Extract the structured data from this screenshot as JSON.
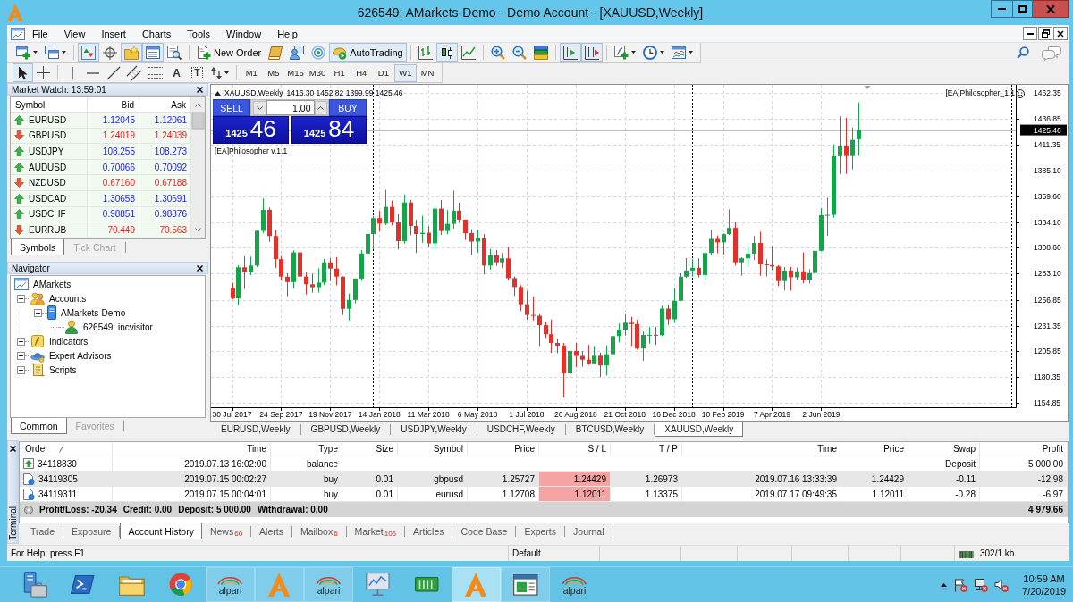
{
  "window": {
    "title": "626549: AMarkets-Demo - Demo Account - [XAUUSD,Weekly]"
  },
  "menu": [
    "File",
    "View",
    "Insert",
    "Charts",
    "Tools",
    "Window",
    "Help"
  ],
  "toolbar_main": {
    "groups": [
      [
        {
          "kind": "new-chart",
          "on": false
        },
        {
          "kind": "profiles",
          "on": false
        }
      ],
      [
        {
          "kind": "market-watch",
          "on": true
        },
        {
          "kind": "data-window",
          "on": false
        },
        {
          "kind": "navigator",
          "on": true
        },
        {
          "kind": "terminal",
          "on": true
        },
        {
          "kind": "tester",
          "on": false
        }
      ],
      [
        {
          "kind": "new-order",
          "label": "New Order",
          "on": false
        },
        {
          "kind": "editor",
          "on": false
        },
        {
          "kind": "community",
          "on": false
        },
        {
          "kind": "signals",
          "on": false
        },
        {
          "kind": "autotrading",
          "label": "AutoTrading",
          "on": true
        }
      ],
      [
        {
          "kind": "bars",
          "on": false
        },
        {
          "kind": "candles",
          "on": true
        },
        {
          "kind": "line",
          "on": false
        }
      ],
      [
        {
          "kind": "zoom-in",
          "on": false
        },
        {
          "kind": "zoom-out",
          "on": false
        },
        {
          "kind": "tile",
          "on": false
        }
      ],
      [
        {
          "kind": "autoscroll",
          "on": true
        },
        {
          "kind": "shift",
          "on": true
        }
      ],
      [
        {
          "kind": "indicators",
          "on": false
        },
        {
          "kind": "periods",
          "on": false
        },
        {
          "kind": "templates",
          "on": false
        }
      ]
    ]
  },
  "toolbar_draw": {
    "groups": [
      [
        {
          "kind": "cursor",
          "on": true
        },
        {
          "kind": "crosshair",
          "on": false
        }
      ],
      [
        {
          "kind": "vline",
          "on": false
        },
        {
          "kind": "hline",
          "on": false
        },
        {
          "kind": "trendline",
          "on": false
        },
        {
          "kind": "channel",
          "on": false
        },
        {
          "kind": "fibo",
          "on": false
        },
        {
          "kind": "text",
          "glyph": "A",
          "on": false
        },
        {
          "kind": "label",
          "glyph": "T",
          "on": false
        },
        {
          "kind": "arrows",
          "on": false
        }
      ]
    ],
    "timeframes": [
      {
        "label": "M1",
        "selected": false
      },
      {
        "label": "M5",
        "selected": false
      },
      {
        "label": "M15",
        "selected": false
      },
      {
        "label": "M30",
        "selected": false
      },
      {
        "label": "H1",
        "selected": false
      },
      {
        "label": "H4",
        "selected": false
      },
      {
        "label": "D1",
        "selected": false
      },
      {
        "label": "W1",
        "selected": true
      },
      {
        "label": "MN",
        "selected": false
      }
    ]
  },
  "market_watch": {
    "title": "Market Watch: 13:59:01",
    "columns": [
      "Symbol",
      "Bid",
      "Ask"
    ],
    "rows": [
      {
        "symbol": "EURUSD",
        "bid": "1.12045",
        "ask": "1.12061",
        "rising": true
      },
      {
        "symbol": "GBPUSD",
        "bid": "1.24019",
        "ask": "1.24039",
        "rising": false
      },
      {
        "symbol": "USDJPY",
        "bid": "108.255",
        "ask": "108.273",
        "rising": true
      },
      {
        "symbol": "AUDUSD",
        "bid": "0.70066",
        "ask": "0.70092",
        "rising": true
      },
      {
        "symbol": "NZDUSD",
        "bid": "0.67160",
        "ask": "0.67188",
        "rising": false
      },
      {
        "symbol": "USDCAD",
        "bid": "1.30658",
        "ask": "1.30691",
        "rising": true
      },
      {
        "symbol": "USDCHF",
        "bid": "0.98851",
        "ask": "0.98876",
        "rising": true
      },
      {
        "symbol": "EURRUB",
        "bid": "70.449",
        "ask": "70.563",
        "rising": false
      }
    ],
    "tabs": [
      {
        "label": "Symbols",
        "selected": true
      },
      {
        "label": "Tick Chart",
        "selected": false
      }
    ]
  },
  "navigator": {
    "title": "Navigator",
    "tree": [
      {
        "label": "AMarkets",
        "kind": "terminal",
        "children": [
          {
            "label": "Accounts",
            "kind": "accounts",
            "expanded": true,
            "children": [
              {
                "label": "AMarkets-Demo",
                "kind": "server",
                "expanded": true,
                "children": [
                  {
                    "label": "626549: incvisitor",
                    "kind": "user"
                  }
                ]
              }
            ]
          },
          {
            "label": "Indicators",
            "kind": "indicators",
            "expanded": false
          },
          {
            "label": "Expert Advisors",
            "kind": "experts",
            "expanded": false
          },
          {
            "label": "Scripts",
            "kind": "scripts",
            "expanded": false
          }
        ]
      }
    ],
    "tabs": [
      {
        "label": "Common",
        "selected": true
      },
      {
        "label": "Favorites",
        "selected": false
      }
    ]
  },
  "chart": {
    "ea_label": "[EA]Philosopher v.1.1",
    "ea_corner": "[EA]Philosopher_1.1",
    "one_click": {
      "sell": "SELL",
      "buy": "BUY",
      "lot": "1.00",
      "sell_price": {
        "figure": "1425",
        "pips": "46"
      },
      "buy_price": {
        "figure": "1425",
        "pips": "84"
      }
    },
    "chart_data": [
      {
        "type": "candlestick",
        "title": "XAUUSD,Weekly",
        "subtitle": "1416.30 1452.82 1399.99 1425.46",
        "grid": true,
        "x": [
          "2017-07-30",
          "2017-08-06",
          "2017-08-13",
          "2017-08-20",
          "2017-08-27",
          "2017-09-03",
          "2017-09-10",
          "2017-09-17",
          "2017-09-24",
          "2017-10-01",
          "2017-10-08",
          "2017-10-15",
          "2017-10-22",
          "2017-10-29",
          "2017-11-05",
          "2017-11-12",
          "2017-11-19",
          "2017-11-26",
          "2017-12-03",
          "2017-12-10",
          "2017-12-17",
          "2017-12-24",
          "2017-12-31",
          "2018-01-07",
          "2018-01-14",
          "2018-01-21",
          "2018-01-28",
          "2018-02-04",
          "2018-02-11",
          "2018-02-18",
          "2018-02-25",
          "2018-03-04",
          "2018-03-11",
          "2018-03-18",
          "2018-03-25",
          "2018-04-01",
          "2018-04-08",
          "2018-04-15",
          "2018-04-22",
          "2018-04-29",
          "2018-05-06",
          "2018-05-13",
          "2018-05-20",
          "2018-05-27",
          "2018-06-03",
          "2018-06-10",
          "2018-06-17",
          "2018-06-24",
          "2018-07-01",
          "2018-07-08",
          "2018-07-15",
          "2018-07-22",
          "2018-07-29",
          "2018-08-05",
          "2018-08-12",
          "2018-08-19",
          "2018-08-26",
          "2018-09-02",
          "2018-09-09",
          "2018-09-16",
          "2018-09-23",
          "2018-09-30",
          "2018-10-07",
          "2018-10-14",
          "2018-10-21",
          "2018-10-28",
          "2018-11-04",
          "2018-11-11",
          "2018-11-18",
          "2018-11-25",
          "2018-12-02",
          "2018-12-09",
          "2018-12-16",
          "2018-12-23",
          "2018-12-30",
          "2019-01-06",
          "2019-01-13",
          "2019-01-20",
          "2019-01-27",
          "2019-02-03",
          "2019-02-10",
          "2019-02-17",
          "2019-02-24",
          "2019-03-03",
          "2019-03-10",
          "2019-03-17",
          "2019-03-24",
          "2019-03-31",
          "2019-04-07",
          "2019-04-14",
          "2019-04-21",
          "2019-04-28",
          "2019-05-05",
          "2019-05-12",
          "2019-05-19",
          "2019-05-26",
          "2019-06-02",
          "2019-06-09",
          "2019-06-16",
          "2019-06-23",
          "2019-06-30",
          "2019-07-07",
          "2019-07-14"
        ],
        "ohlc": [
          [
            1268.5,
            1274.0,
            1257.6,
            1258.5
          ],
          [
            1258.5,
            1291.2,
            1251.7,
            1289.3
          ],
          [
            1289.3,
            1300.1,
            1267.8,
            1284.6
          ],
          [
            1284.6,
            1299.9,
            1281.4,
            1291.0
          ],
          [
            1291.0,
            1326.0,
            1289.5,
            1325.4
          ],
          [
            1325.4,
            1357.6,
            1323.3,
            1346.3
          ],
          [
            1346.3,
            1348.5,
            1314.6,
            1320.3
          ],
          [
            1320.3,
            1326.3,
            1288.4,
            1297.4
          ],
          [
            1297.4,
            1300.3,
            1276.0,
            1280.0
          ],
          [
            1280.0,
            1283.1,
            1260.6,
            1274.6
          ],
          [
            1274.6,
            1306.1,
            1268.3,
            1304.1
          ],
          [
            1304.1,
            1306.1,
            1276.2,
            1280.1
          ],
          [
            1280.1,
            1284.4,
            1262.3,
            1272.4
          ],
          [
            1272.4,
            1283.0,
            1264.1,
            1269.5
          ],
          [
            1269.5,
            1288.3,
            1264.4,
            1274.1
          ],
          [
            1274.1,
            1297.5,
            1271.6,
            1294.2
          ],
          [
            1294.2,
            1298.5,
            1275.5,
            1288.0
          ],
          [
            1288.0,
            1299.5,
            1271.4,
            1280.0
          ],
          [
            1280.0,
            1280.3,
            1241.9,
            1248.1
          ],
          [
            1248.1,
            1263.2,
            1236.6,
            1256.9
          ],
          [
            1256.9,
            1278.3,
            1253.5,
            1278.1
          ],
          [
            1278.1,
            1306.6,
            1276.0,
            1303.0
          ],
          [
            1303.0,
            1326.3,
            1301.6,
            1322.3
          ],
          [
            1322.3,
            1340.4,
            1307.1,
            1338.1
          ],
          [
            1338.1,
            1345.2,
            1324.8,
            1332.6
          ],
          [
            1332.6,
            1366.1,
            1331.1,
            1349.2
          ],
          [
            1349.2,
            1355.4,
            1330.7,
            1333.8
          ],
          [
            1333.8,
            1341.9,
            1307.0,
            1315.2
          ],
          [
            1315.2,
            1361.5,
            1312.8,
            1353.6
          ],
          [
            1353.6,
            1356.2,
            1321.2,
            1330.3
          ],
          [
            1330.3,
            1336.5,
            1303.5,
            1322.3
          ],
          [
            1322.3,
            1340.3,
            1313.7,
            1323.6
          ],
          [
            1323.6,
            1330.1,
            1309.6,
            1313.0
          ],
          [
            1313.0,
            1349.3,
            1306.5,
            1347.5
          ],
          [
            1347.5,
            1356.0,
            1321.4,
            1325.3
          ],
          [
            1325.3,
            1346.1,
            1322.0,
            1332.4
          ],
          [
            1332.4,
            1365.3,
            1327.7,
            1345.5
          ],
          [
            1345.5,
            1353.3,
            1334.2,
            1336.5
          ],
          [
            1336.5,
            1336.8,
            1316.5,
            1323.2
          ],
          [
            1323.2,
            1327.1,
            1301.5,
            1314.8
          ],
          [
            1314.8,
            1326.5,
            1303.7,
            1318.4
          ],
          [
            1318.4,
            1322.3,
            1282.2,
            1291.0
          ],
          [
            1291.0,
            1307.4,
            1286.9,
            1301.2
          ],
          [
            1301.2,
            1306.5,
            1290.7,
            1294.3
          ],
          [
            1294.3,
            1303.5,
            1288.4,
            1298.1
          ],
          [
            1298.1,
            1309.3,
            1276.2,
            1278.5
          ],
          [
            1278.5,
            1280.1,
            1261.0,
            1269.7
          ],
          [
            1269.7,
            1271.6,
            1245.8,
            1252.6
          ],
          [
            1252.6,
            1265.9,
            1237.1,
            1242.0
          ],
          [
            1242.0,
            1260.2,
            1236.6,
            1241.2
          ],
          [
            1241.2,
            1243.0,
            1211.1,
            1231.8
          ],
          [
            1231.8,
            1235.4,
            1219.2,
            1222.9
          ],
          [
            1222.9,
            1237.4,
            1204.5,
            1214.2
          ],
          [
            1214.2,
            1218.6,
            1204.0,
            1211.6
          ],
          [
            1211.6,
            1214.3,
            1160.2,
            1184.0
          ],
          [
            1184.0,
            1214.4,
            1183.2,
            1206.3
          ],
          [
            1206.3,
            1214.5,
            1190.0,
            1201.3
          ],
          [
            1201.3,
            1206.2,
            1190.6,
            1197.6
          ],
          [
            1197.6,
            1212.2,
            1192.4,
            1194.0
          ],
          [
            1194.0,
            1211.1,
            1193.6,
            1201.5
          ],
          [
            1201.5,
            1204.7,
            1180.2,
            1191.9
          ],
          [
            1191.9,
            1211.8,
            1181.9,
            1203.0
          ],
          [
            1203.0,
            1233.3,
            1185.8,
            1221.0
          ],
          [
            1221.0,
            1233.5,
            1214.8,
            1227.4
          ],
          [
            1227.4,
            1243.4,
            1221.6,
            1234.3
          ],
          [
            1234.3,
            1240.0,
            1211.3,
            1233.0
          ],
          [
            1233.0,
            1237.2,
            1207.6,
            1208.7
          ],
          [
            1208.7,
            1225.6,
            1196.4,
            1222.2
          ],
          [
            1222.2,
            1230.3,
            1213.5,
            1222.3
          ],
          [
            1222.3,
            1230.2,
            1212.5,
            1221.9
          ],
          [
            1221.9,
            1251.2,
            1221.0,
            1248.3
          ],
          [
            1248.3,
            1252.2,
            1232.1,
            1237.7
          ],
          [
            1237.7,
            1268.6,
            1234.3,
            1256.1
          ],
          [
            1256.1,
            1283.5,
            1255.7,
            1280.0
          ],
          [
            1280.0,
            1298.4,
            1278.7,
            1286.1
          ],
          [
            1286.1,
            1297.6,
            1279.9,
            1288.8
          ],
          [
            1288.8,
            1298.2,
            1279.3,
            1281.6
          ],
          [
            1281.6,
            1305.0,
            1276.1,
            1303.5
          ],
          [
            1303.5,
            1326.4,
            1301.9,
            1317.4
          ],
          [
            1317.4,
            1320.8,
            1303.2,
            1314.0
          ],
          [
            1314.0,
            1322.9,
            1302.0,
            1322.2
          ],
          [
            1322.2,
            1346.8,
            1321.3,
            1328.4
          ],
          [
            1328.4,
            1334.1,
            1291.1,
            1294.2
          ],
          [
            1294.2,
            1299.4,
            1280.9,
            1298.2
          ],
          [
            1298.2,
            1310.3,
            1289.1,
            1302.8
          ],
          [
            1302.8,
            1320.3,
            1296.6,
            1313.4
          ],
          [
            1313.4,
            1324.6,
            1280.9,
            1292.2
          ],
          [
            1292.2,
            1297.2,
            1280.2,
            1291.5
          ],
          [
            1291.5,
            1310.6,
            1286.4,
            1290.1
          ],
          [
            1290.1,
            1291.3,
            1270.5,
            1275.6
          ],
          [
            1275.6,
            1289.5,
            1266.3,
            1286.0
          ],
          [
            1286.0,
            1289.7,
            1266.2,
            1279.4
          ],
          [
            1279.4,
            1289.0,
            1276.8,
            1285.3
          ],
          [
            1285.3,
            1304.0,
            1273.3,
            1276.8
          ],
          [
            1276.8,
            1287.4,
            1273.0,
            1283.6
          ],
          [
            1283.6,
            1306.0,
            1275.6,
            1305.6
          ],
          [
            1305.6,
            1348.0,
            1305.0,
            1340.9
          ],
          [
            1340.9,
            1358.3,
            1320.5,
            1341.3
          ],
          [
            1341.3,
            1411.2,
            1338.5,
            1399.5
          ],
          [
            1399.5,
            1439.1,
            1381.6,
            1409.5
          ],
          [
            1409.5,
            1437.7,
            1381.8,
            1399.7
          ],
          [
            1399.7,
            1427.8,
            1386.4,
            1415.6
          ],
          [
            1416.3,
            1452.82,
            1399.99,
            1425.46
          ]
        ],
        "xlim": [
          "2017-07-06",
          "2020-01-10"
        ],
        "ylim": [
          1150.4,
          1469.4
        ],
        "xticks": [
          {
            "value": "2017-07-30",
            "label": "30 Jul 2017"
          },
          {
            "value": "2017-09-24",
            "label": "24 Sep 2017"
          },
          {
            "value": "2017-11-19",
            "label": "19 Nov 2017"
          },
          {
            "value": "2018-01-14",
            "label": "14 Jan 2018"
          },
          {
            "value": "2018-03-11",
            "label": "11 Mar 2018"
          },
          {
            "value": "2018-05-06",
            "label": "6 May 2018"
          },
          {
            "value": "2018-07-01",
            "label": "1 Jul 2018"
          },
          {
            "value": "2018-08-26",
            "label": "26 Aug 2018"
          },
          {
            "value": "2018-10-21",
            "label": "21 Oct 2018"
          },
          {
            "value": "2018-12-16",
            "label": "16 Dec 2018"
          },
          {
            "value": "2019-02-10",
            "label": "10 Feb 2019"
          },
          {
            "value": "2019-04-07",
            "label": "7 Apr 2019"
          },
          {
            "value": "2019-06-02",
            "label": "2 Jun 2019"
          }
        ],
        "yticks": [
          {
            "value": 1462.35,
            "label": "1462.35"
          },
          {
            "value": 1436.85,
            "label": "1436.85"
          },
          {
            "value": 1411.35,
            "label": "1411.35"
          },
          {
            "value": 1385.1,
            "label": "1385.10"
          },
          {
            "value": 1359.6,
            "label": "1359.60"
          },
          {
            "value": 1334.1,
            "label": "1334.10"
          },
          {
            "value": 1308.6,
            "label": "1308.60"
          },
          {
            "value": 1283.1,
            "label": "1283.10"
          },
          {
            "value": 1256.85,
            "label": "1256.85"
          },
          {
            "value": 1231.35,
            "label": "1231.35"
          },
          {
            "value": 1205.85,
            "label": "1205.85"
          },
          {
            "value": 1180.35,
            "label": "1180.35"
          },
          {
            "value": 1154.85,
            "label": "1154.85"
          }
        ],
        "ref_lines": [
          {
            "axis": "x",
            "value": "2018-01-07",
            "color": "#000000",
            "line_style": "dashed"
          },
          {
            "axis": "x",
            "value": "2019-01-06",
            "color": "#000000",
            "line_style": "dashed"
          },
          {
            "axis": "x",
            "value": "2020-01-05",
            "color": "#000000",
            "line_style": "dashed"
          },
          {
            "axis": "y",
            "value": 1425.46,
            "label": "1425.46",
            "color": "#c0c0c0",
            "line_style": "solid"
          }
        ]
      }
    ]
  },
  "chart_tabs": [
    {
      "label": "EURUSD,Weekly",
      "selected": false
    },
    {
      "label": "GBPUSD,Weekly",
      "selected": false
    },
    {
      "label": "USDJPY,Weekly",
      "selected": false
    },
    {
      "label": "USDCHF,Weekly",
      "selected": false
    },
    {
      "label": "BTCUSD,Weekly",
      "selected": false
    },
    {
      "label": "XAUUSD,Weekly",
      "selected": true
    }
  ],
  "terminal": {
    "title": "Terminal",
    "columns": [
      "Order",
      "Time",
      "Type",
      "Size",
      "Symbol",
      "Price",
      "S / L",
      "T / P",
      "Time",
      "Price",
      "Swap",
      "Profit"
    ],
    "rows": [
      {
        "kind": "balance",
        "order": "34118830",
        "time": "2019.07.13 16:02:00",
        "type": "balance",
        "comment": "Deposit",
        "profit": "5 000.00",
        "selected": false
      },
      {
        "kind": "trade",
        "order": "34119305",
        "time": "2019.07.15 00:02:27",
        "type": "buy",
        "size": "0.01",
        "symbol": "gbpusd",
        "price": "1.25727",
        "sl": "1.24429",
        "tp": "1.26973",
        "close_time": "2019.07.16 13:33:39",
        "close_price": "1.24429",
        "swap": "-0.11",
        "profit": "-12.98",
        "sl_hit": true,
        "selected": true
      },
      {
        "kind": "trade",
        "order": "34119311",
        "time": "2019.07.15 00:04:01",
        "type": "buy",
        "size": "0.01",
        "symbol": "eurusd",
        "price": "1.12708",
        "sl": "1.12011",
        "tp": "1.13375",
        "close_time": "2019.07.17 09:49:35",
        "close_price": "1.12011",
        "swap": "-0.28",
        "profit": "-6.97",
        "sl_hit": true,
        "selected": false
      }
    ],
    "summary": {
      "items": [
        "Profit/Loss: -20.34",
        "Credit: 0.00",
        "Deposit: 5 000.00",
        "Withdrawal: 0.00"
      ],
      "total": "4 979.66"
    },
    "tabs": [
      {
        "label": "Trade",
        "selected": false
      },
      {
        "label": "Exposure",
        "selected": false
      },
      {
        "label": "Account History",
        "selected": true
      },
      {
        "label": "News",
        "count": "60",
        "selected": false
      },
      {
        "label": "Alerts",
        "selected": false
      },
      {
        "label": "Mailbox",
        "count": "6",
        "selected": false
      },
      {
        "label": "Market",
        "count": "106",
        "selected": false
      },
      {
        "label": "Articles",
        "selected": false
      },
      {
        "label": "Code Base",
        "selected": false
      },
      {
        "label": "Experts",
        "selected": false
      },
      {
        "label": "Journal",
        "selected": false
      }
    ]
  },
  "status_bar": {
    "help": "For Help, press F1",
    "profile": "Default",
    "traffic": "302/1 kb"
  },
  "taskbar": {
    "items": [
      {
        "kind": "server-manager",
        "open": false,
        "selected": false
      },
      {
        "kind": "powershell",
        "open": false,
        "selected": false
      },
      {
        "kind": "explorer",
        "open": false,
        "selected": false
      },
      {
        "kind": "browser",
        "open": false,
        "selected": false
      },
      {
        "kind": "alpari",
        "label": "alpari",
        "open": true,
        "selected": false
      },
      {
        "kind": "amarkets",
        "open": true,
        "selected": false
      },
      {
        "kind": "alpari",
        "label": "alpari",
        "open": true,
        "selected": false
      },
      {
        "kind": "monitor",
        "open": false,
        "selected": false
      },
      {
        "kind": "board",
        "open": false,
        "selected": false
      },
      {
        "kind": "amarkets",
        "open": true,
        "selected": true
      },
      {
        "kind": "window",
        "open": true,
        "selected": false
      },
      {
        "kind": "alpari",
        "label": "alpari",
        "open": false,
        "selected": false
      }
    ],
    "time": "10:59 AM",
    "date": "7/20/2019"
  }
}
